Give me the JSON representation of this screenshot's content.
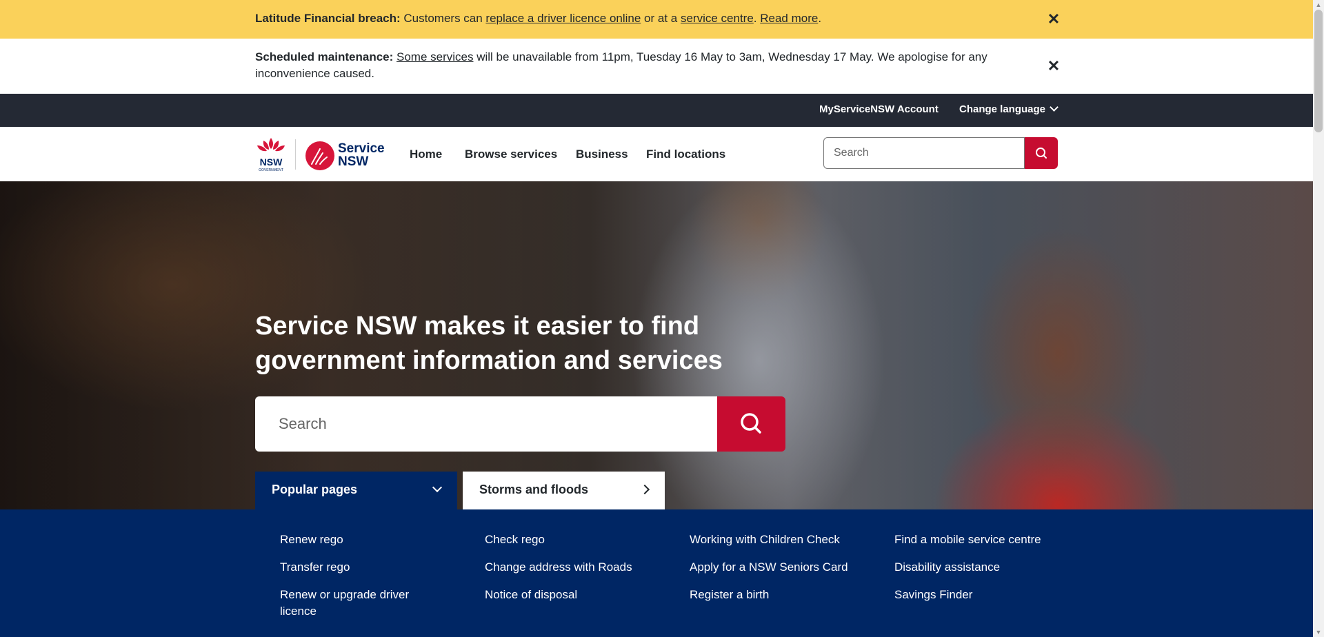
{
  "alerts": {
    "breach": {
      "title": "Latitude Financial breach:",
      "pre": " Customers can ",
      "link1": "replace a driver licence online",
      "mid": " or at a ",
      "link2": "service centre",
      "sep": ". ",
      "link3": "Read more",
      "end": "."
    },
    "maintenance": {
      "title": "Scheduled maintenance:",
      "link1": "Some services",
      "text": " will be unavailable from 11pm, Tuesday 16 May to 3am, Wednesday 17 May. We apologise for any inconvenience caused."
    },
    "close_glyph": "✕"
  },
  "utility": {
    "account": "MyServiceNSW Account",
    "language": "Change language"
  },
  "header": {
    "logo_nsw_text": "NSW",
    "logo_nsw_sub": "GOVERNMENT",
    "logo_service": "Service",
    "logo_service_nsw": "NSW",
    "nav": [
      "Home",
      "Browse services",
      "Business",
      "Find locations"
    ],
    "search_placeholder": "Search"
  },
  "hero": {
    "title": "Service NSW makes it easier to find government information and services",
    "search_placeholder": "Search"
  },
  "tabs": {
    "popular": "Popular pages",
    "storms": "Storms and floods"
  },
  "popular_pages": {
    "col1": [
      "Renew rego",
      "Transfer rego",
      "Renew or upgrade driver licence"
    ],
    "col2": [
      "Check rego",
      "Change address with Roads",
      "Notice of disposal"
    ],
    "col3": [
      "Working with Children Check",
      "Apply for a NSW Seniors Card",
      "Register a birth"
    ],
    "col4": [
      "Find a mobile service centre",
      "Disability assistance",
      "Savings Finder"
    ]
  },
  "colors": {
    "alert_yellow": "#fad15a",
    "utility_bg": "#242934",
    "brand_red": "#c60c30",
    "brand_navy": "#002664"
  }
}
